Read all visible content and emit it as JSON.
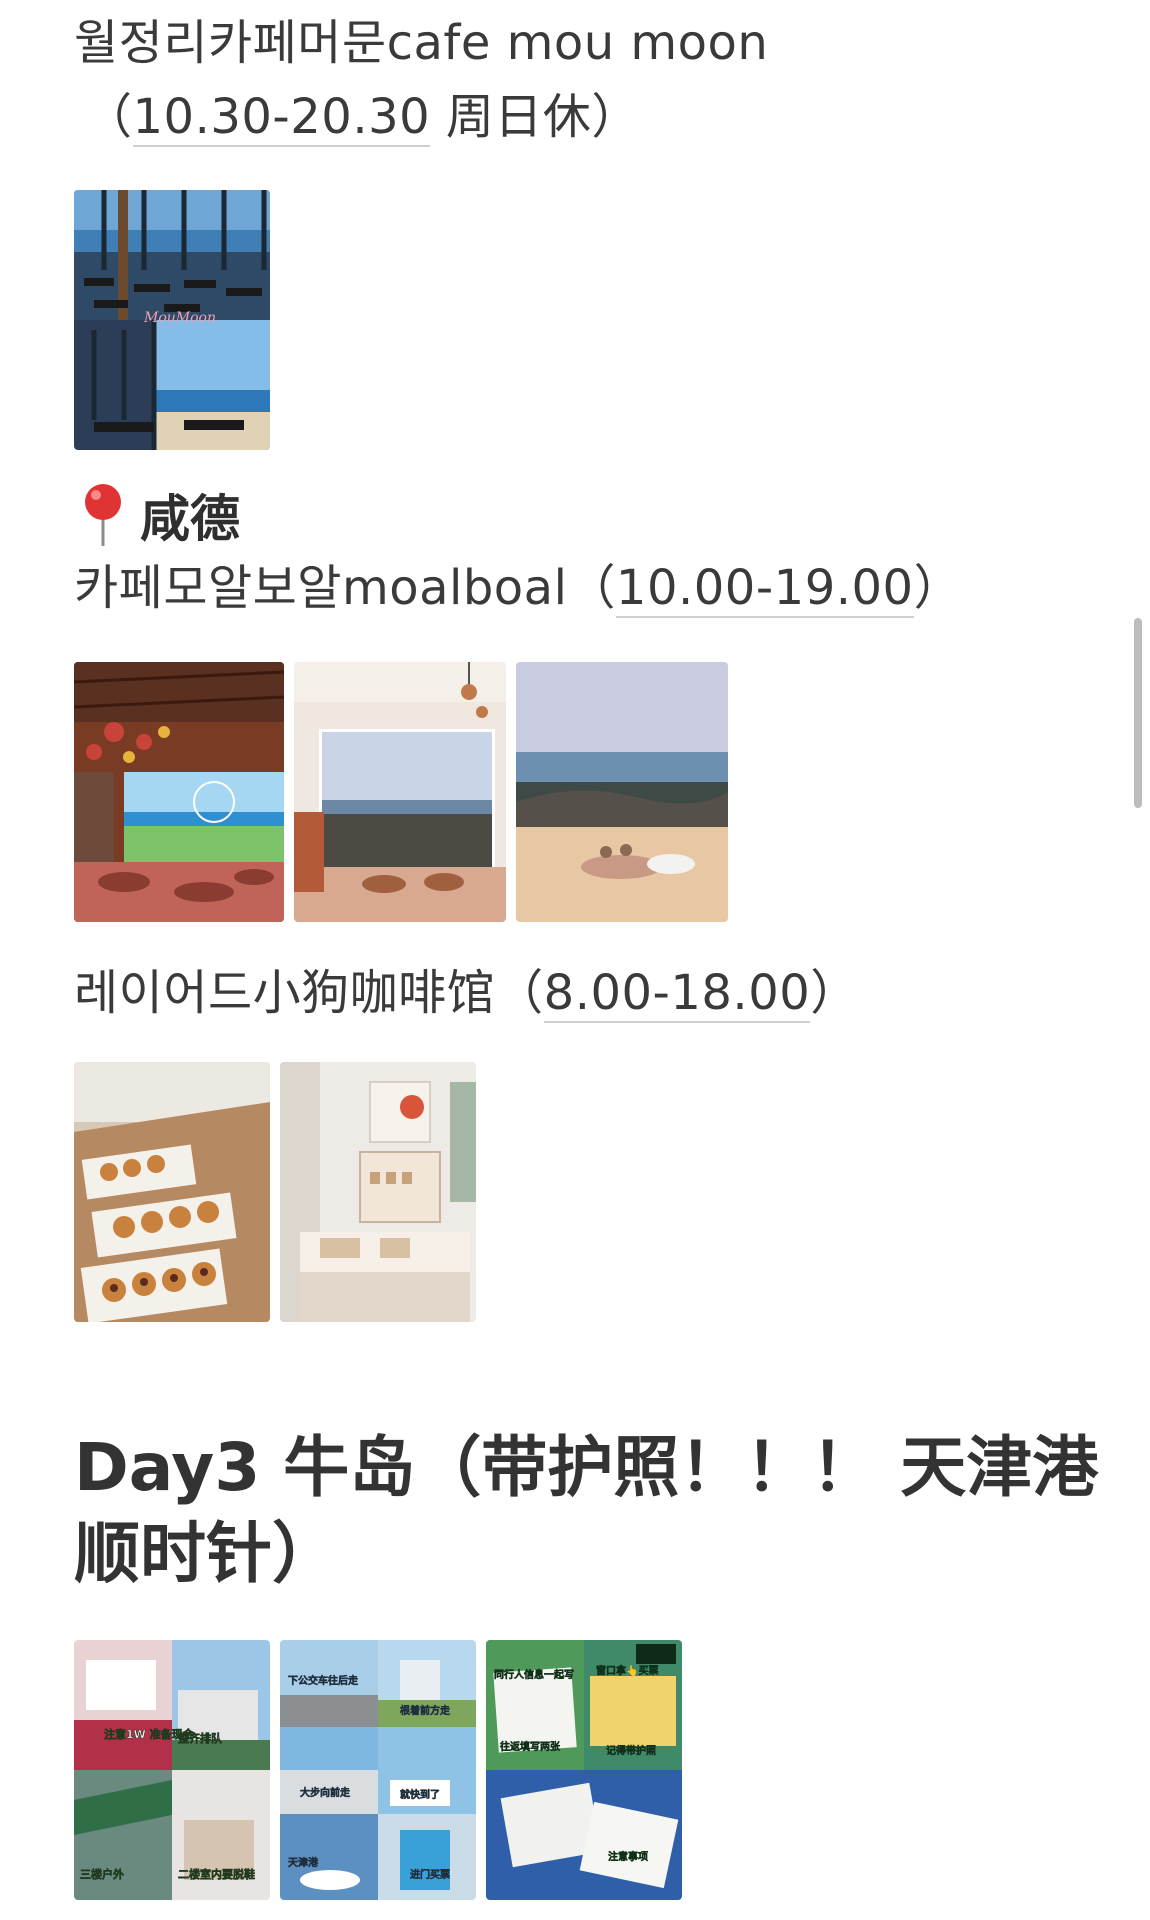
{
  "section1": {
    "title": "월정리카페머문cafe mou moon",
    "hours_prefix": "（",
    "hours": "10.30-20.30",
    "hours_suffix": " 周日休）",
    "image_sign": "MouMoon"
  },
  "section2": {
    "location": "咸德",
    "pin_icon": "round-pushpin-icon",
    "cafe1": {
      "name": "카페모알보알moalboal（",
      "hours": "10.00-19.00",
      "suffix": "）"
    },
    "cafe2": {
      "name": "레이어드小狗咖啡馆（",
      "hours": "8.00-18.00",
      "suffix": "）"
    }
  },
  "day3": {
    "heading_line1": "Day3 牛岛（带护照！！！ 天津港",
    "heading_line2": "顺时针）",
    "photo1": {
      "label_tl": "注意1W\n准备现金",
      "label_tr": "整齐排队",
      "label_bl": "三楼户外",
      "label_br": "二楼室内要脱鞋"
    },
    "photo2": {
      "label_tl": "下公交车往后走",
      "label_tr": "根着前方走",
      "label_ml": "大步向前走",
      "label_mr": "就快到了",
      "label_bl": "天津港",
      "label_br": "进门买票"
    },
    "photo3": {
      "label_tl": "同行人信息一起写",
      "label_tr": "窗口拿👆买票",
      "label_ml": "往返填写两张",
      "label_mr": "记得带护照",
      "label_br": "注意事项"
    }
  }
}
